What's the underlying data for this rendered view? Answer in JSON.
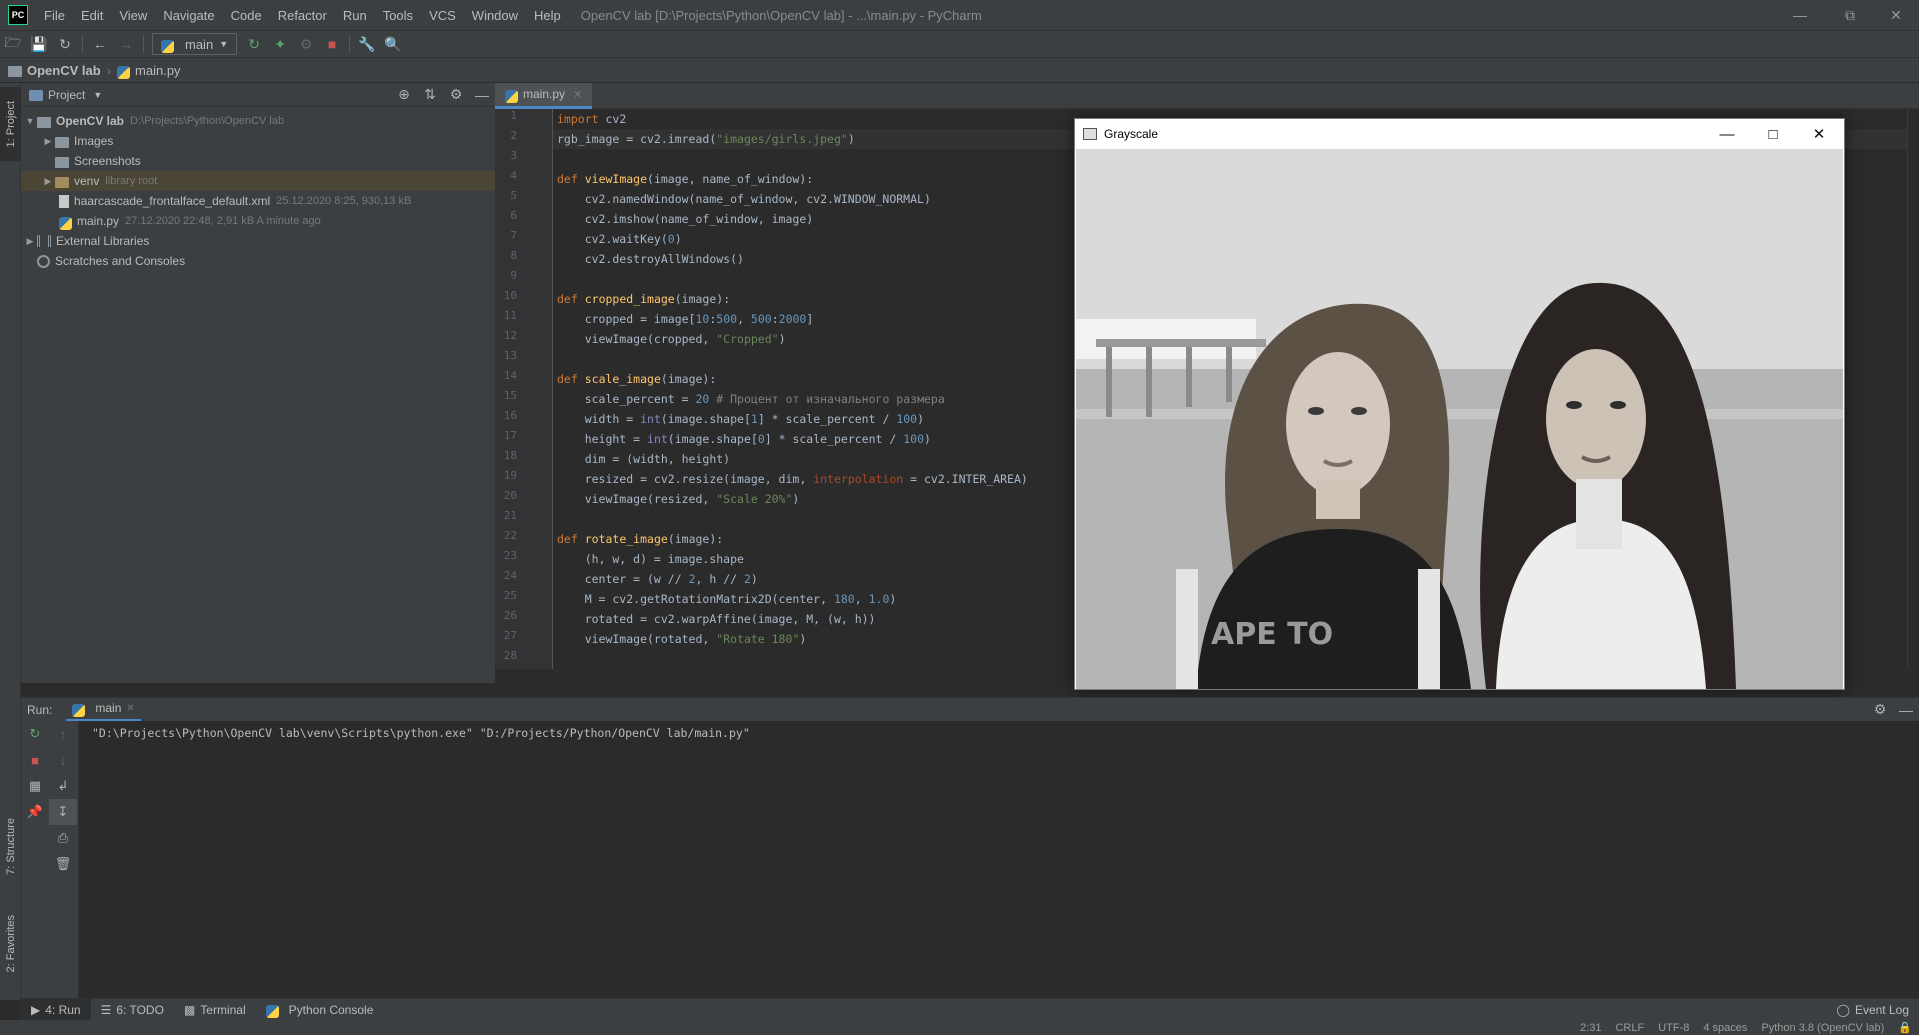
{
  "app": {
    "logo": "PC",
    "window_title": "OpenCV lab [D:\\Projects\\Python\\OpenCV lab] - ...\\main.py - PyCharm",
    "menu": [
      "File",
      "Edit",
      "View",
      "Navigate",
      "Code",
      "Refactor",
      "Run",
      "Tools",
      "VCS",
      "Window",
      "Help"
    ]
  },
  "toolbar": {
    "run_config": "main"
  },
  "navbar": {
    "project": "OpenCV lab",
    "file": "main.py"
  },
  "stripe": {
    "project": "1: Project",
    "structure": "7: Structure",
    "favorites": "2: Favorites"
  },
  "project_panel": {
    "title": "Project",
    "root_name": "OpenCV lab",
    "root_path": "D:\\Projects\\Python\\OpenCV lab",
    "items": [
      {
        "name": "Images",
        "hint": ""
      },
      {
        "name": "Screenshots",
        "hint": ""
      },
      {
        "name": "venv",
        "hint": "library root"
      },
      {
        "name": "haarcascade_frontalface_default.xml",
        "hint": "25.12.2020 8:25, 930,13 kB"
      },
      {
        "name": "main.py",
        "hint": "27.12.2020 22:48, 2,91 kB A minute ago"
      },
      {
        "name": "External Libraries",
        "hint": ""
      },
      {
        "name": "Scratches and Consoles",
        "hint": ""
      }
    ]
  },
  "editor": {
    "tab": "main.py",
    "line_numbers": [
      "1",
      "2",
      "3",
      "4",
      "5",
      "6",
      "7",
      "8",
      "9",
      "10",
      "11",
      "12",
      "13",
      "14",
      "15",
      "16",
      "17",
      "18",
      "19",
      "20",
      "21",
      "22",
      "23",
      "24",
      "25",
      "26",
      "27",
      "28"
    ]
  },
  "cv_window": {
    "title": "Grayscale",
    "shirt_text": "APE TO"
  },
  "run_panel": {
    "label": "Run:",
    "tab": "main",
    "command": "\"D:\\Projects\\Python\\OpenCV lab\\venv\\Scripts\\python.exe\" \"D:/Projects/Python/OpenCV lab/main.py\""
  },
  "bottom_tabs": {
    "run": "4: Run",
    "todo": "6: TODO",
    "terminal": "Terminal",
    "console": "Python Console",
    "event_log": "Event Log"
  },
  "status": {
    "position": "2:31",
    "line_sep": "CRLF",
    "encoding": "UTF-8",
    "indent": "4 spaces",
    "interpreter": "Python 3.8 (OpenCV lab)"
  }
}
